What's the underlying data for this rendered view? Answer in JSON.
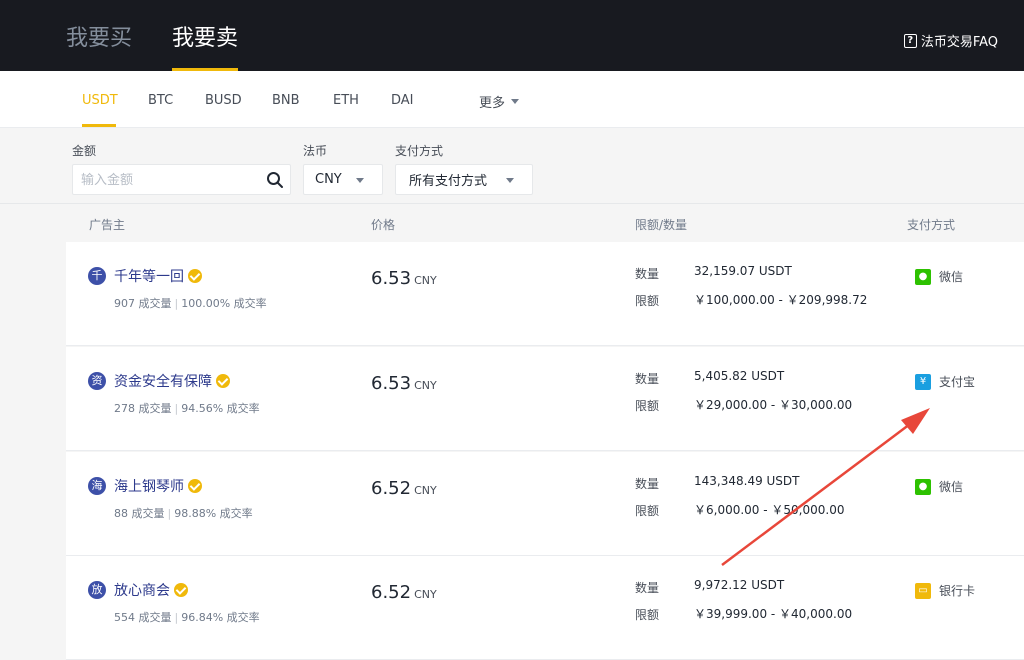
{
  "header": {
    "tab_buy": "我要买",
    "tab_sell": "我要卖",
    "faq": "法币交易FAQ"
  },
  "coins": [
    "USDT",
    "BTC",
    "BUSD",
    "BNB",
    "ETH",
    "DAI"
  ],
  "more_label": "更多",
  "filters": {
    "amount_label": "金额",
    "amount_placeholder": "输入金额",
    "fiat_label": "法币",
    "fiat_value": "CNY",
    "payment_label": "支付方式",
    "payment_value": "所有支付方式"
  },
  "columns": {
    "advertiser": "广告主",
    "price": "价格",
    "limit": "限额/数量",
    "payment": "支付方式"
  },
  "labels": {
    "amount": "数量",
    "limit": "限额"
  },
  "ads": [
    {
      "avatar": "千",
      "name": "千年等一回",
      "orders": "907 成交量",
      "rate": "100.00% 成交率",
      "price": "6.53",
      "currency": "CNY",
      "amount": "32,159.07 USDT",
      "limit": "￥100,000.00 - ￥209,998.72",
      "payment": "微信",
      "payment_icon": "wechat-icon",
      "payment_color": "#2dc100"
    },
    {
      "avatar": "资",
      "name": "资金安全有保障",
      "orders": "278 成交量",
      "rate": "94.56% 成交率",
      "price": "6.53",
      "currency": "CNY",
      "amount": "5,405.82 USDT",
      "limit": "￥29,000.00 - ￥30,000.00",
      "payment": "支付宝",
      "payment_icon": "alipay-icon",
      "payment_color": "#1a9fe0"
    },
    {
      "avatar": "海",
      "name": "海上钢琴师",
      "orders": "88 成交量",
      "rate": "98.88% 成交率",
      "price": "6.52",
      "currency": "CNY",
      "amount": "143,348.49 USDT",
      "limit": "￥6,000.00 - ￥50,000.00",
      "payment": "微信",
      "payment_icon": "wechat-icon",
      "payment_color": "#2dc100"
    },
    {
      "avatar": "放",
      "name": "放心商会",
      "orders": "554 成交量",
      "rate": "96.84% 成交率",
      "price": "6.52",
      "currency": "CNY",
      "amount": "9,972.12 USDT",
      "limit": "￥39,999.00 - ￥40,000.00",
      "payment": "银行卡",
      "payment_icon": "bank-card-icon",
      "payment_color": "#f0b90b"
    }
  ],
  "colors": {
    "accent": "#f0b90b",
    "header_bg": "#181a20",
    "arrow": "#e8473a"
  }
}
